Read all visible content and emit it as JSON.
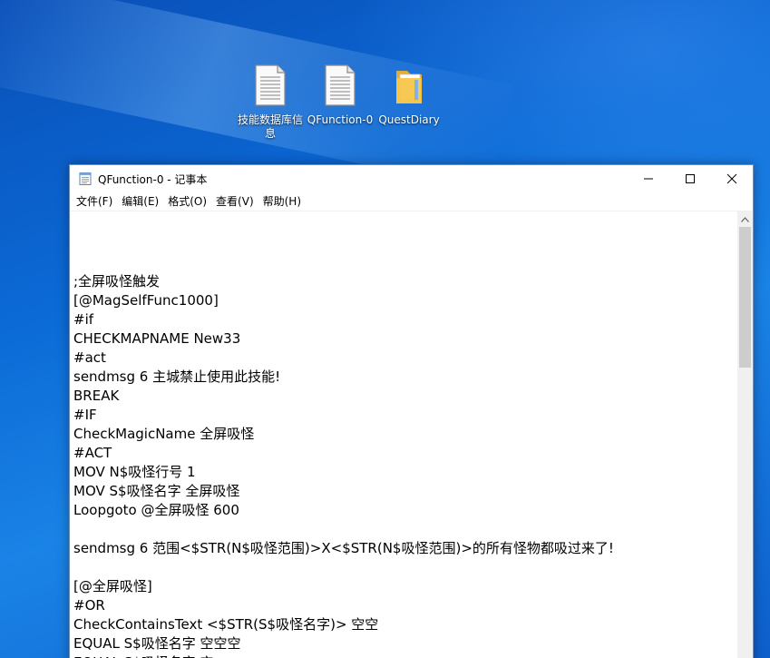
{
  "desktop": {
    "icons": [
      {
        "label": "技能数据库信息",
        "type": "text-file"
      },
      {
        "label": "QFunction-0",
        "type": "text-file"
      },
      {
        "label": "QuestDiary",
        "type": "folder"
      }
    ]
  },
  "window": {
    "title": "QFunction-0 - 记事本",
    "app_icon": "notepad-icon",
    "controls": {
      "minimize": "minimize-icon",
      "maximize": "maximize-icon",
      "close": "close-icon"
    }
  },
  "menu": [
    "文件(F)",
    "编辑(E)",
    "格式(O)",
    "查看(V)",
    "帮助(H)"
  ],
  "content": {
    "lines": [
      "",
      "",
      "",
      ";全屏吸怪触发",
      "[@MagSelfFunc1000]",
      "#if",
      "CHECKMAPNAME New33",
      "#act",
      "sendmsg 6 主城禁止使用此技能!",
      "BREAK",
      "#IF",
      "CheckMagicName 全屏吸怪",
      "#ACT",
      "MOV N$吸怪行号 1",
      "MOV S$吸怪名字 全屏吸怪",
      "Loopgoto @全屏吸怪 600",
      "",
      "sendmsg 6 范围<$STR(N$吸怪范围)>X<$STR(N$吸怪范围)>的所有怪物都吸过来了!",
      "",
      "[@全屏吸怪]",
      "#OR",
      "CheckContainsText <$STR(S$吸怪名字)> 空空",
      "EQUAL S$吸怪名字 空空空",
      "EQUAL S$吸怪名字 空"
    ]
  },
  "colors": {
    "desktop": "#0b6ad6",
    "window_border": "#6f8fb3",
    "scrollbar_track": "#f0f0f0",
    "scrollbar_thumb": "#cdcdcd",
    "folder": "#f4c64a"
  }
}
